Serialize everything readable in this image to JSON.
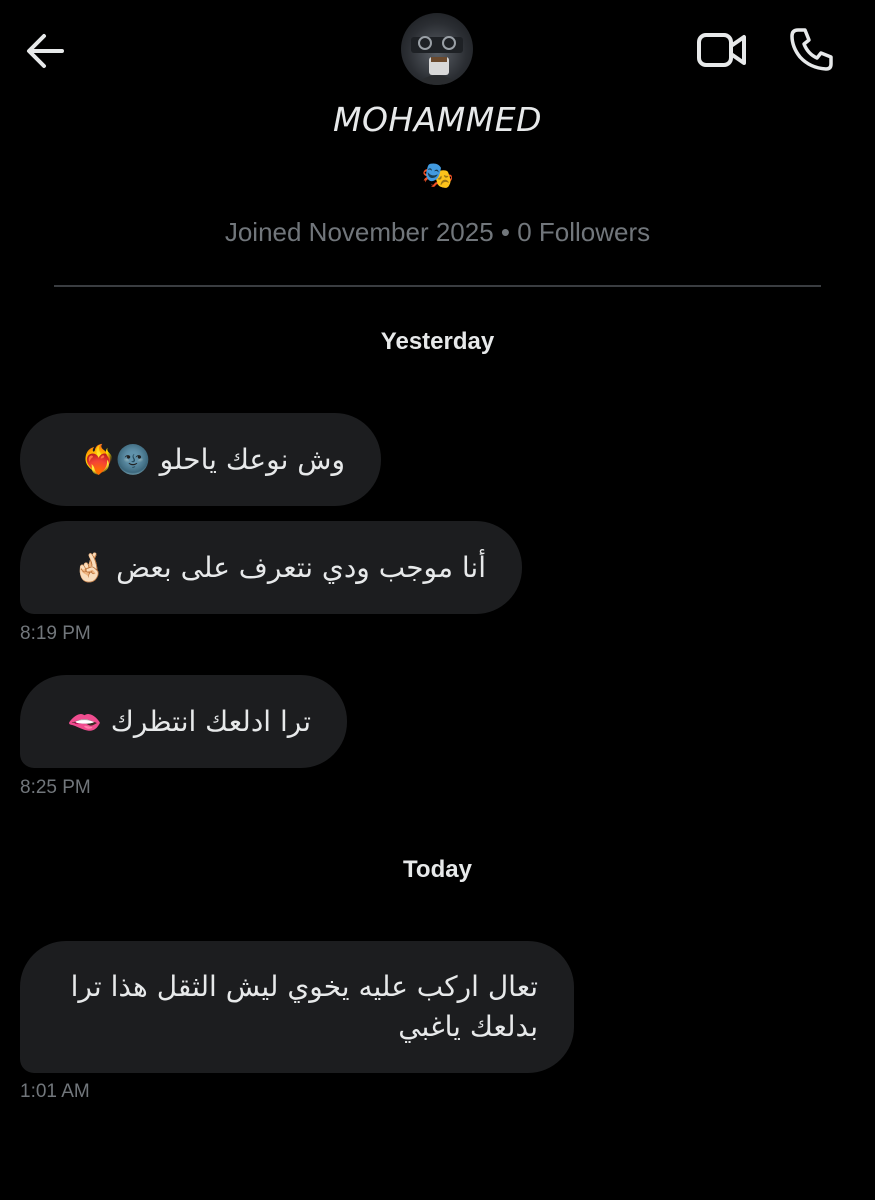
{
  "header": {
    "back_icon": "arrow-left-icon",
    "video_icon": "video-camera-icon",
    "phone_icon": "phone-icon",
    "name": "MOHAMMED",
    "badge": "🎭",
    "meta": "Joined November 2025 • 0 Followers"
  },
  "conversation": {
    "day1": "Yesterday",
    "day2": "Today",
    "messages": [
      {
        "text": "وش نوعك ياحلو 🌚❤️‍🔥"
      },
      {
        "text": "أنا موجب ودي نتعرف على بعض 🤞🏻"
      },
      {
        "time": "8:19 PM"
      },
      {
        "text": "ترا ادلعك انتظرك 🫦"
      },
      {
        "time": "8:25 PM"
      },
      {
        "text": "تعال اركب عليه يخوي ليش الثقل هذا ترا بدلعك ياغبي"
      },
      {
        "time": "1:01 AM"
      }
    ]
  },
  "colors": {
    "background": "#000000",
    "bubble": "#1c1d1f",
    "text": "#e7e9ea",
    "muted": "#71767b"
  }
}
